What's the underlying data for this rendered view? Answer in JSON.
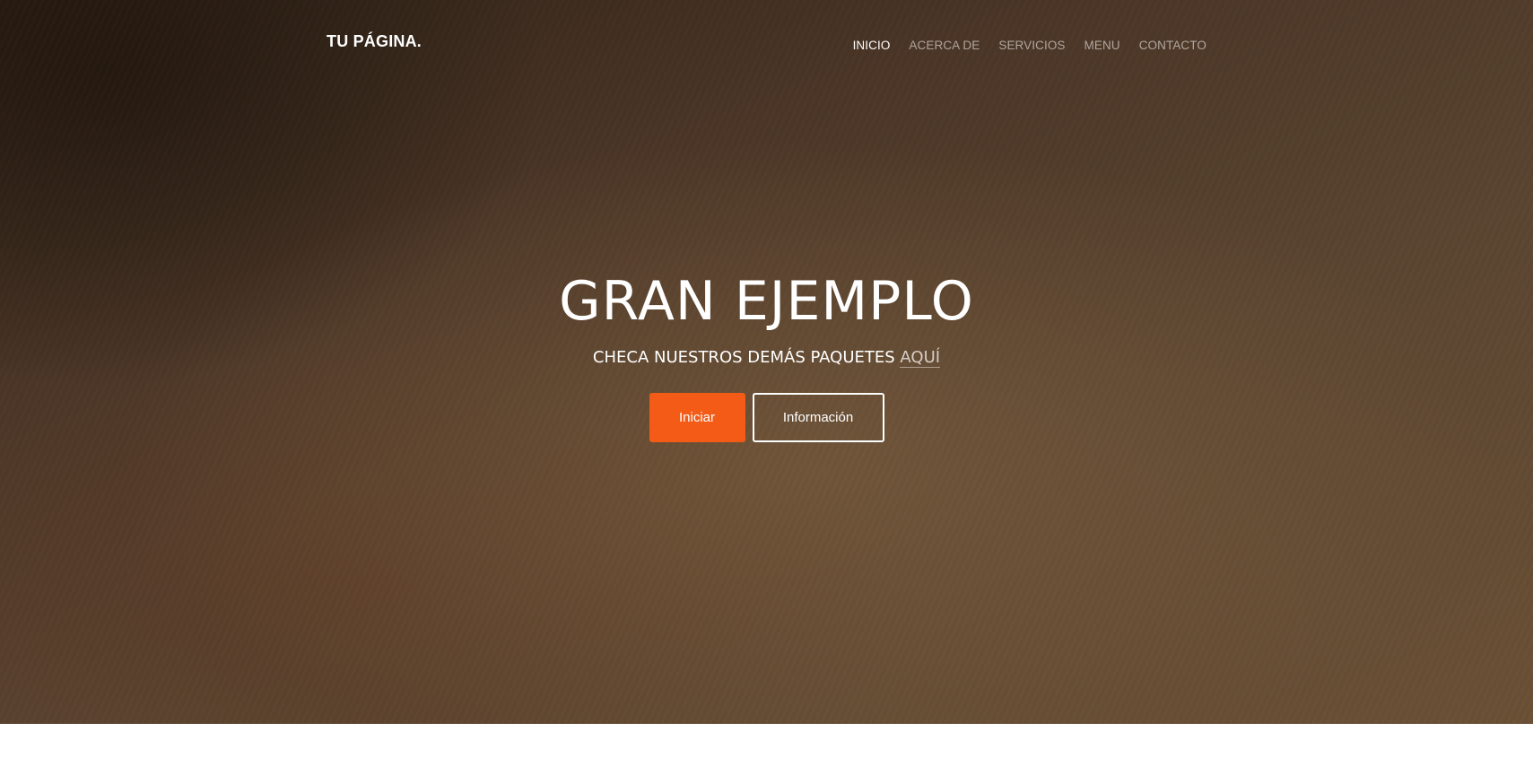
{
  "navbar": {
    "brand": "TU PÁGINA.",
    "links": [
      {
        "label": "INICIO",
        "active": true
      },
      {
        "label": "ACERCA DE",
        "active": false
      },
      {
        "label": "SERVICIOS",
        "active": false
      },
      {
        "label": "MENU",
        "active": false
      },
      {
        "label": "CONTACTO",
        "active": false
      }
    ]
  },
  "hero": {
    "title": "GRAN EJEMPLO",
    "subtitle_text": "CHECA NUESTROS DEMÁS PAQUETES ",
    "subtitle_link": "AQUÍ",
    "primary_button": "Iniciar",
    "secondary_button": "Información"
  },
  "colors": {
    "accent": "#f45b17",
    "hero_background": "#4f3a28",
    "text": "#ffffff"
  }
}
